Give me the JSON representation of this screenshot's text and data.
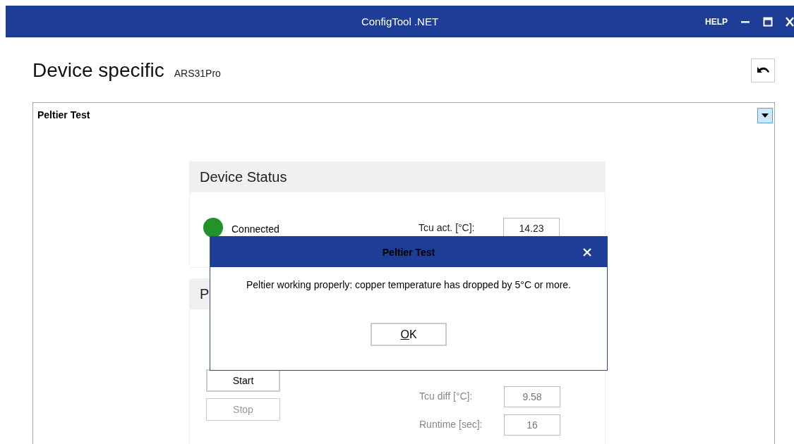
{
  "window": {
    "title": "ConfigTool .NET",
    "controls": [
      "HELP"
    ]
  },
  "page": {
    "title": "Device specific",
    "device": "ARS31Pro"
  },
  "group": {
    "title": "Peltier Test",
    "expanded": true
  },
  "device_status": {
    "title": "Device Status",
    "connected": true,
    "status_label": "Connected",
    "reading_label": "Tcu act. [°C]:",
    "reading": "14.23"
  },
  "test_panel": {
    "title": "P",
    "buttons": [
      {
        "label": "Start",
        "disabled": false
      },
      {
        "label": "Stop",
        "disabled": true
      }
    ],
    "readings": [
      {
        "label": "Tcu diff [°C]:",
        "value": "9.58"
      },
      {
        "label": "Runtime [sec]:",
        "value": "16"
      }
    ]
  },
  "dialog": {
    "title": "Peltier Test",
    "message": "Peltier working properly: copper temperature has dropped by 5°C or more.",
    "button": {
      "label": "OK"
    }
  }
}
